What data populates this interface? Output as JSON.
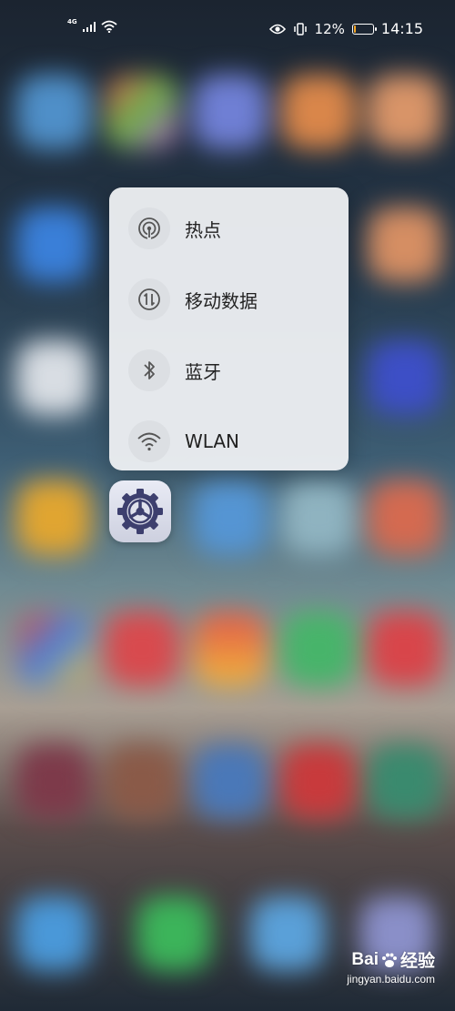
{
  "status_bar": {
    "network_type": "4G",
    "battery_percent": "12%",
    "battery_level": 0.12,
    "time": "14:15",
    "icons": [
      "signal-icon",
      "wifi-icon",
      "eye-icon",
      "vibrate-icon",
      "battery-icon"
    ]
  },
  "popup_menu": {
    "items": [
      {
        "label": "热点",
        "icon": "hotspot-icon"
      },
      {
        "label": "移动数据",
        "icon": "mobile-data-icon"
      },
      {
        "label": "蓝牙",
        "icon": "bluetooth-icon"
      },
      {
        "label": "WLAN",
        "icon": "wifi-icon"
      }
    ]
  },
  "app": {
    "icon": "settings-gear-icon",
    "colors": {
      "gear": "#3d3f6e",
      "background": "#dfe1ec"
    }
  },
  "watermark": {
    "brand": "Bai",
    "brand_suffix": "经验",
    "url": "jingyan.baidu.com"
  },
  "colors": {
    "popup_background": "#eceef1",
    "icon_circle": "#dcdfe3",
    "text": "#222222",
    "battery_low": "#f5a623"
  }
}
